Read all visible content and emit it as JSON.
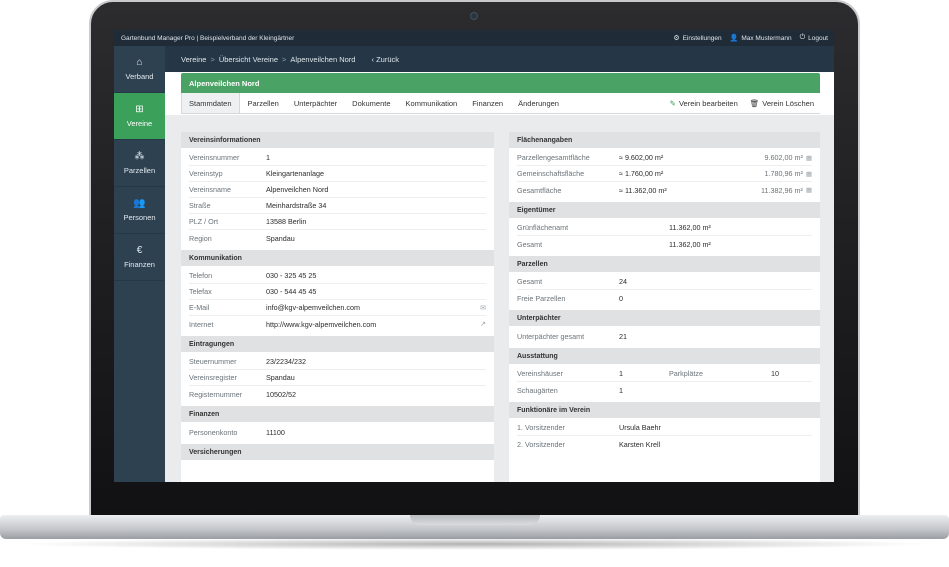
{
  "app": {
    "title": "Gartenbund Manager Pro | Beispielverband der Kleingärtner",
    "top_links": [
      {
        "icon": "gear-icon",
        "glyph": "⚙",
        "label": "Einstellungen"
      },
      {
        "icon": "user-icon",
        "glyph": "👤",
        "label": "Max Mustermann"
      },
      {
        "icon": "power-icon",
        "glyph": "⏻",
        "label": "Logout"
      }
    ]
  },
  "sidebar": {
    "items": [
      {
        "icon": "home-icon",
        "glyph": "⌂",
        "label": "Verband",
        "active": false
      },
      {
        "icon": "sitemap-icon",
        "glyph": "⊞",
        "label": "Vereine",
        "active": true
      },
      {
        "icon": "cubes-icon",
        "glyph": "⁂",
        "label": "Parzellen",
        "active": false
      },
      {
        "icon": "users-icon",
        "glyph": "👥",
        "label": "Personen",
        "active": false
      },
      {
        "icon": "euro-icon",
        "glyph": "€",
        "label": "Finanzen",
        "active": false
      }
    ]
  },
  "breadcrumb": {
    "items": [
      "Vereine",
      "Übersicht Vereine",
      "Alpenveilchen Nord"
    ],
    "separator": ">",
    "back_label": "Zurück"
  },
  "club_title": "Alpenveilchen Nord",
  "tabs": [
    {
      "label": "Stammdaten",
      "active": true
    },
    {
      "label": "Parzellen",
      "active": false
    },
    {
      "label": "Unterpächter",
      "active": false
    },
    {
      "label": "Dokumente",
      "active": false
    },
    {
      "label": "Kommunikation",
      "active": false
    },
    {
      "label": "Finanzen",
      "active": false
    },
    {
      "label": "Änderungen",
      "active": false
    }
  ],
  "actions": {
    "edit_label": "Verein bearbeiten",
    "delete_label": "Verein Löschen"
  },
  "left": {
    "vereinsinfo": {
      "title": "Vereinsinformationen",
      "rows": [
        {
          "label": "Vereinsnummer",
          "value": "1"
        },
        {
          "label": "Vereinstyp",
          "value": "Kleingartenanlage"
        },
        {
          "label": "Vereinsname",
          "value": "Alpenveilchen Nord"
        },
        {
          "label": "Straße",
          "value": "Meinhardstraße 34"
        },
        {
          "label": "PLZ / Ort",
          "value": "13588 Berlin"
        },
        {
          "label": "Region",
          "value": "Spandau"
        }
      ]
    },
    "kommunikation": {
      "title": "Kommunikation",
      "rows": [
        {
          "label": "Telefon",
          "value": "030 - 325 45 25"
        },
        {
          "label": "Telefax",
          "value": "030 - 544 45 45"
        },
        {
          "label": "E-Mail",
          "value": "info@kgv-alpemveilchen.com"
        },
        {
          "label": "Internet",
          "value": "http://www.kgv-alpemveilchen.com"
        }
      ]
    },
    "eintragungen": {
      "title": "Eintragungen",
      "rows": [
        {
          "label": "Steuernummer",
          "value": "23/2234/232"
        },
        {
          "label": "Vereinsregister",
          "value": "Spandau"
        },
        {
          "label": "Registernummer",
          "value": "10502/52"
        }
      ]
    },
    "finanzen": {
      "title": "Finanzen",
      "rows": [
        {
          "label": "Personenkonto",
          "value": "11100"
        }
      ]
    },
    "versicherungen": {
      "title": "Versicherungen"
    }
  },
  "right": {
    "flaechen": {
      "title": "Flächenangaben",
      "rows": [
        {
          "label": "Parzellengesamtfläche",
          "value": "≈ 9.602,00 m²",
          "value2": "9.602,00 m²"
        },
        {
          "label": "Gemeinschaftsfläche",
          "value": "≈ 1.760,00 m²",
          "value2": "1.780,96 m²"
        },
        {
          "label": "Gesamtfläche",
          "value": "≈ 11.362,00 m²",
          "value2": "11.382,96 m²"
        }
      ]
    },
    "eigentuemer": {
      "title": "Eigentümer",
      "rows": [
        {
          "label": "Grünflächenamt",
          "value": "11.362,00 m²"
        },
        {
          "label": "Gesamt",
          "value": "11.362,00 m²"
        }
      ]
    },
    "parzellen": {
      "title": "Parzellen",
      "rows": [
        {
          "label": "Gesamt",
          "value": "24"
        },
        {
          "label": "Freie Parzellen",
          "value": "0"
        }
      ]
    },
    "unterpaechter": {
      "title": "Unterpächter",
      "rows": [
        {
          "label": "Unterpächter gesamt",
          "value": "21"
        }
      ]
    },
    "ausstattung": {
      "title": "Ausstattung",
      "rows": [
        {
          "label": "Vereinshäuser",
          "value": "1",
          "label2": "Parkplätze",
          "value2": "10"
        },
        {
          "label": "Schaugärten",
          "value": "1",
          "label2": "",
          "value2": ""
        }
      ]
    },
    "funktionaere": {
      "title": "Funktionäre im Verein",
      "rows": [
        {
          "label": "1. Vorsitzender",
          "value": "Ursula Baehr"
        },
        {
          "label": "2. Vorsitzender",
          "value": "Karsten Krell"
        }
      ]
    }
  },
  "icons": {
    "mail_glyph": "✉",
    "link_glyph": "↗",
    "calc_glyph": "▦",
    "edit_glyph": "✎",
    "trash_glyph": "🗑",
    "back_glyph": "‹"
  },
  "colors": {
    "accent_green": "#4aa364",
    "sidebar_bg": "#2d4151",
    "topbar_bg": "#1f2b37"
  }
}
